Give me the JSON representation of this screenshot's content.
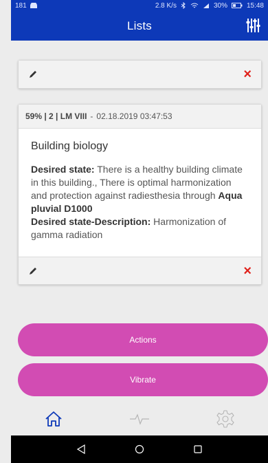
{
  "status_bar": {
    "left_text": "181",
    "speed": "2.8 K/s",
    "battery": "30%",
    "time": "15:48"
  },
  "app_bar": {
    "title": "Lists"
  },
  "cards": [
    {
      "actions": {
        "edit_icon": "pencil-icon",
        "delete_label": "×"
      }
    },
    {
      "header": {
        "meta": "59% | 2 | LM VIII",
        "separator": "-",
        "datetime": "02.18.2019 03:47:53"
      },
      "body": {
        "title": "Building biology",
        "desired_state_label": "Desired state:",
        "desired_state_text": " There is a healthy building climate in this building., There is optimal harmonization and protection against radiesthesia through ",
        "product_name": "Aqua pluvial D1000",
        "desired_state_desc_label": "Desired state-Description:",
        "desired_state_desc_text": " Harmonization of gamma radiation"
      },
      "actions": {
        "edit_icon": "pencil-icon",
        "delete_label": "×"
      }
    }
  ],
  "buttons": {
    "actions_label": "Actions",
    "vibrate_label": "Vibrate"
  },
  "tab_bar": {
    "tabs": [
      {
        "icon": "home-icon",
        "active": true
      },
      {
        "icon": "pulse-icon",
        "active": false
      },
      {
        "icon": "gear-icon",
        "active": false
      }
    ]
  },
  "colors": {
    "primary": "#0d39b8",
    "accent": "#d24cb3",
    "delete": "#e0201a"
  }
}
